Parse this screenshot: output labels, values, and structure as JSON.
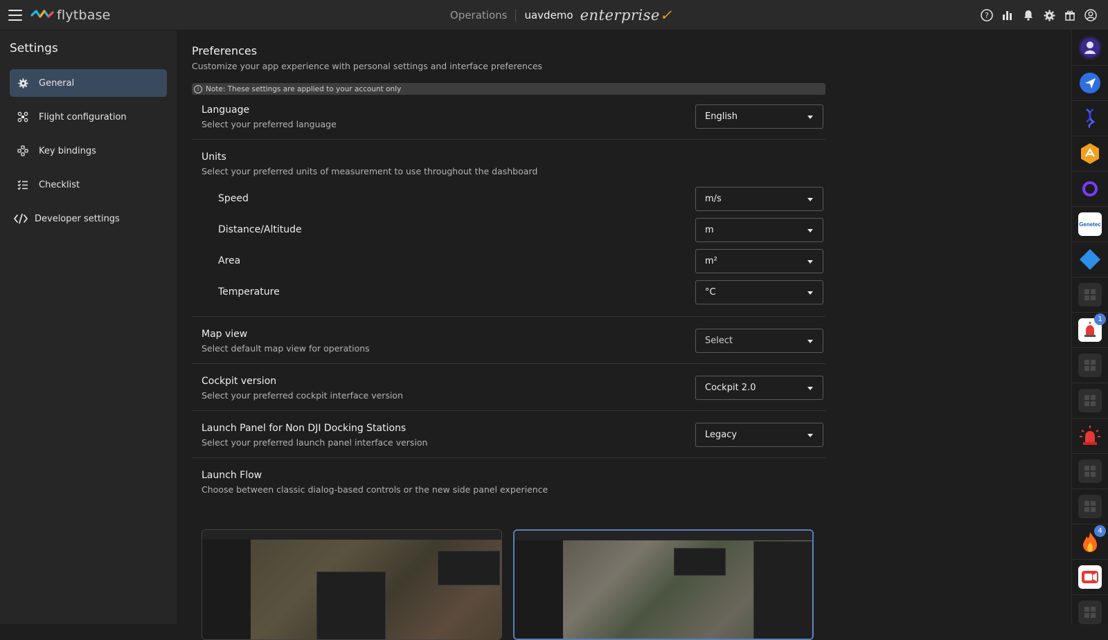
{
  "topbar": {
    "logo_text": "flytbase",
    "operations_label": "Operations",
    "org_name": "uavdemo",
    "edition_label": "enterprise",
    "icons": [
      "help-icon",
      "analytics-icon",
      "bell-icon",
      "gear-icon",
      "gift-icon",
      "user-icon"
    ]
  },
  "sidebar": {
    "title": "Settings",
    "items": [
      {
        "label": "General",
        "icon": "gear-icon",
        "active": true
      },
      {
        "label": "Flight configuration",
        "icon": "drone-icon"
      },
      {
        "label": "Key bindings",
        "icon": "key-bindings-icon"
      },
      {
        "label": "Checklist",
        "icon": "checklist-icon"
      },
      {
        "label": "Developer settings",
        "icon": "code-icon"
      }
    ]
  },
  "main": {
    "title": "Preferences",
    "subtitle": "Customize your app experience with personal settings and interface preferences",
    "note": "Note: These settings are applied to your account only",
    "language": {
      "title": "Language",
      "subtitle": "Select your preferred language",
      "value": "English"
    },
    "units": {
      "title": "Units",
      "subtitle": "Select your preferred units of measurement to use throughout the dashboard",
      "items": [
        {
          "label": "Speed",
          "value": "m/s"
        },
        {
          "label": "Distance/Altitude",
          "value": "m"
        },
        {
          "label": "Area",
          "value": "m²"
        },
        {
          "label": "Temperature",
          "value": "°C"
        }
      ]
    },
    "map_view": {
      "title": "Map view",
      "subtitle": "Select default map view for operations",
      "value": "Select"
    },
    "cockpit": {
      "title": "Cockpit version",
      "subtitle": "Select your preferred cockpit interface version",
      "value": "Cockpit 2.0"
    },
    "launch_panel": {
      "title": "Launch Panel for Non DJI Docking Stations",
      "subtitle": "Select your preferred launch panel interface version",
      "value": "Legacy"
    },
    "launch_flow": {
      "title": "Launch Flow",
      "subtitle": "Choose between classic dialog-based controls or the new side panel experience"
    }
  },
  "rail": {
    "items": [
      {
        "icon": "profile-app-icon"
      },
      {
        "icon": "send-app-icon"
      },
      {
        "icon": "dna-app-icon"
      },
      {
        "icon": "hex-app-icon"
      },
      {
        "icon": "ring-app-icon"
      },
      {
        "icon": "genetec-app-icon",
        "text": "Genetec"
      },
      {
        "icon": "diamond-app-icon"
      },
      {
        "icon": "placeholder-app-icon"
      },
      {
        "icon": "alarm-app-icon",
        "badge": "1"
      },
      {
        "icon": "placeholder-app-icon"
      },
      {
        "icon": "placeholder-app-icon"
      },
      {
        "icon": "siren-app-icon"
      },
      {
        "icon": "placeholder-app-icon"
      },
      {
        "icon": "placeholder-app-icon"
      },
      {
        "icon": "fire-app-icon",
        "badge": "4"
      },
      {
        "icon": "camera-app-icon"
      },
      {
        "icon": "placeholder-app-icon"
      }
    ]
  }
}
